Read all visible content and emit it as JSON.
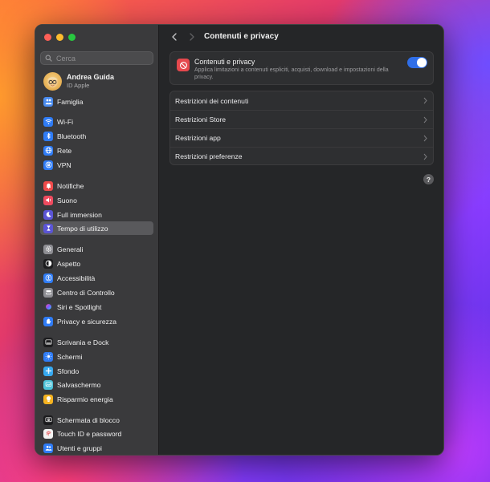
{
  "window": {
    "title": "Contenuti e privacy"
  },
  "search": {
    "placeholder": "Cerca"
  },
  "profile": {
    "name": "Andrea Guida",
    "subtitle": "ID Apple"
  },
  "sidebar": {
    "items": [
      {
        "label": "Famiglia",
        "icon": "family-icon",
        "color": "#4a8cf0"
      },
      {
        "label": "Wi-Fi",
        "icon": "wifi-icon",
        "color": "#2f7cf6"
      },
      {
        "label": "Bluetooth",
        "icon": "bluetooth-icon",
        "color": "#2f7cf6"
      },
      {
        "label": "Rete",
        "icon": "globe-icon",
        "color": "#2f7cf6"
      },
      {
        "label": "VPN",
        "icon": "vpn-icon",
        "color": "#2f7cf6"
      },
      {
        "label": "Notifiche",
        "icon": "bell-icon",
        "color": "#ef4b4b"
      },
      {
        "label": "Suono",
        "icon": "speaker-icon",
        "color": "#ef4b5f"
      },
      {
        "label": "Full immersion",
        "icon": "moon-icon",
        "color": "#5b55d6"
      },
      {
        "label": "Tempo di utilizzo",
        "icon": "hourglass-icon",
        "color": "#5b55d6",
        "selected": true
      },
      {
        "label": "Generali",
        "icon": "gear-icon",
        "color": "#8e8e93"
      },
      {
        "label": "Aspetto",
        "icon": "appearance-icon",
        "color": "#1c1c1e"
      },
      {
        "label": "Accessibilità",
        "icon": "accessibility-icon",
        "color": "#2f7cf6"
      },
      {
        "label": "Centro di Controllo",
        "icon": "control-center-icon",
        "color": "#8e8e93"
      },
      {
        "label": "Siri e Spotlight",
        "icon": "siri-icon",
        "color": "#3b3b3f"
      },
      {
        "label": "Privacy e sicurezza",
        "icon": "hand-icon",
        "color": "#2f7cf6"
      },
      {
        "label": "Scrivania e Dock",
        "icon": "dock-icon",
        "color": "#1c1c1e"
      },
      {
        "label": "Schermi",
        "icon": "display-icon",
        "color": "#2f7cf6"
      },
      {
        "label": "Sfondo",
        "icon": "wallpaper-icon",
        "color": "#37a9f0"
      },
      {
        "label": "Salvaschermo",
        "icon": "screensaver-icon",
        "color": "#4ec3d9"
      },
      {
        "label": "Risparmio energia",
        "icon": "bulb-icon",
        "color": "#f5b321"
      },
      {
        "label": "Schermata di blocco",
        "icon": "lock-screen-icon",
        "color": "#1c1c1e"
      },
      {
        "label": "Touch ID e password",
        "icon": "fingerprint-icon",
        "color": "#f2f2f2"
      },
      {
        "label": "Utenti e gruppi",
        "icon": "users-icon",
        "color": "#2f7cf6"
      }
    ]
  },
  "main": {
    "feature": {
      "title": "Contenuti e privacy",
      "description": "Applica limitazioni a contenuti espliciti, acquisti, download e impostazioni della privacy.",
      "enabled": true
    },
    "rows": [
      {
        "label": "Restrizioni dei contenuti"
      },
      {
        "label": "Restrizioni Store"
      },
      {
        "label": "Restrizioni app"
      },
      {
        "label": "Restrizioni preferenze"
      }
    ],
    "help_label": "?"
  }
}
